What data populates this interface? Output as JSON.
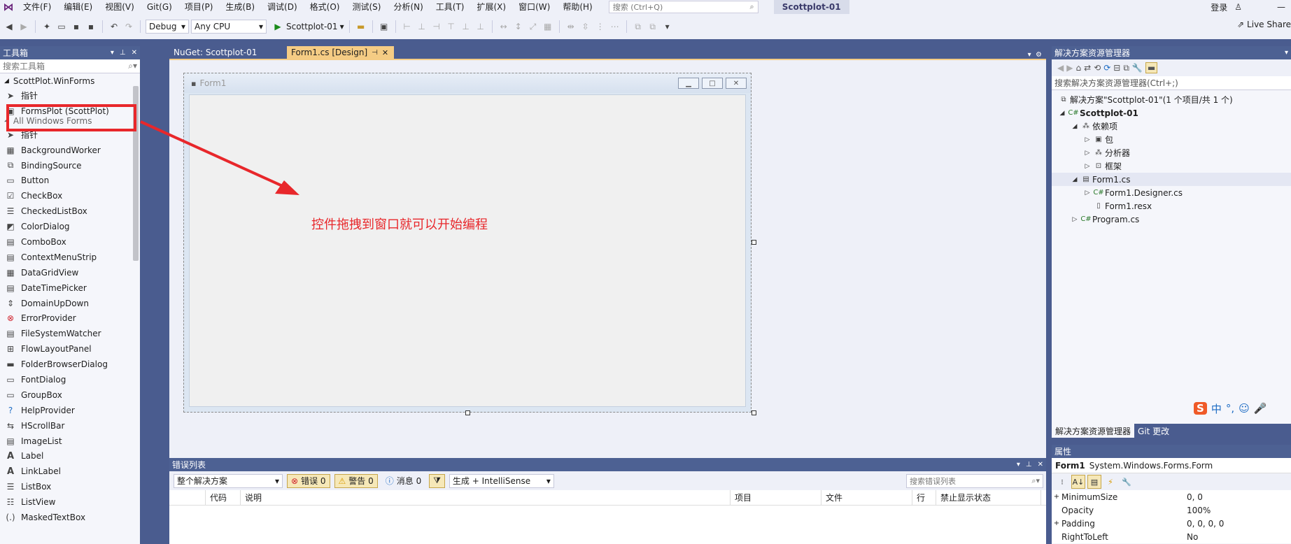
{
  "menubar": {
    "items": [
      "文件(F)",
      "编辑(E)",
      "视图(V)",
      "Git(G)",
      "项目(P)",
      "生成(B)",
      "调试(D)",
      "格式(O)",
      "测试(S)",
      "分析(N)",
      "工具(T)",
      "扩展(X)",
      "窗口(W)",
      "帮助(H)"
    ],
    "search_placeholder": "搜索 (Ctrl+Q)",
    "app_title": "Scottplot-01",
    "login": "登录"
  },
  "toolbar": {
    "config": "Debug",
    "platform": "Any CPU",
    "start_target": "Scottplot-01",
    "live_share": "Live Share"
  },
  "toolbox": {
    "title": "工具箱",
    "search_placeholder": "搜索工具箱",
    "group1": "ScottPlot.WinForms",
    "group1_items": [
      {
        "label": "指针",
        "icon": "pointer-icon"
      },
      {
        "label": "FormsPlot (ScottPlot)",
        "icon": "formsplot-icon"
      }
    ],
    "group2": "All Windows Forms",
    "items": [
      {
        "label": "指针",
        "icon": "pointer-icon"
      },
      {
        "label": "BackgroundWorker",
        "icon": "backgroundworker-icon"
      },
      {
        "label": "BindingSource",
        "icon": "bindingsource-icon"
      },
      {
        "label": "Button",
        "icon": "button-icon"
      },
      {
        "label": "CheckBox",
        "icon": "checkbox-icon"
      },
      {
        "label": "CheckedListBox",
        "icon": "checkedlistbox-icon"
      },
      {
        "label": "ColorDialog",
        "icon": "colordialog-icon"
      },
      {
        "label": "ComboBox",
        "icon": "combobox-icon"
      },
      {
        "label": "ContextMenuStrip",
        "icon": "contextmenustrip-icon"
      },
      {
        "label": "DataGridView",
        "icon": "datagridview-icon"
      },
      {
        "label": "DateTimePicker",
        "icon": "datetimepicker-icon"
      },
      {
        "label": "DomainUpDown",
        "icon": "domainupdown-icon"
      },
      {
        "label": "ErrorProvider",
        "icon": "errorprovider-icon"
      },
      {
        "label": "FileSystemWatcher",
        "icon": "filesystemwatcher-icon"
      },
      {
        "label": "FlowLayoutPanel",
        "icon": "flowlayoutpanel-icon"
      },
      {
        "label": "FolderBrowserDialog",
        "icon": "folderbrowserdialog-icon"
      },
      {
        "label": "FontDialog",
        "icon": "fontdialog-icon"
      },
      {
        "label": "GroupBox",
        "icon": "groupbox-icon"
      },
      {
        "label": "HelpProvider",
        "icon": "helpprovider-icon"
      },
      {
        "label": "HScrollBar",
        "icon": "hscrollbar-icon"
      },
      {
        "label": "ImageList",
        "icon": "imagelist-icon"
      },
      {
        "label": "Label",
        "icon": "label-icon"
      },
      {
        "label": "LinkLabel",
        "icon": "linklabel-icon"
      },
      {
        "label": "ListBox",
        "icon": "listbox-icon"
      },
      {
        "label": "ListView",
        "icon": "listview-icon"
      },
      {
        "label": "MaskedTextBox",
        "icon": "maskedtextbox-icon"
      }
    ]
  },
  "tabs": {
    "nuget": "NuGet: Scottplot-01",
    "form1": "Form1.cs [Design]"
  },
  "designer": {
    "form_title": "Form1",
    "annotation": "控件拖拽到窗口就可以开始编程"
  },
  "errorlist": {
    "title": "错误列表",
    "scope": "整个解决方案",
    "errors": "错误 0",
    "warnings": "警告 0",
    "messages": "消息 0",
    "build_filter": "生成 + IntelliSense",
    "search_placeholder": "搜索错误列表",
    "columns": [
      "代码",
      "说明",
      "项目",
      "文件",
      "行",
      "禁止显示状态"
    ]
  },
  "solution": {
    "title": "解决方案资源管理器",
    "search_placeholder": "搜索解决方案资源管理器(Ctrl+;)",
    "root": "解决方案\"Scottplot-01\"(1 个项目/共 1 个)",
    "project": "Scottplot-01",
    "dependencies": "依赖项",
    "packages": "包",
    "analyzers": "分析器",
    "frameworks": "框架",
    "form1": "Form1.cs",
    "form1_designer": "Form1.Designer.cs",
    "form1_resx": "Form1.resx",
    "program": "Program.cs",
    "tab_solution": "解决方案资源管理器",
    "tab_git": "Git 更改"
  },
  "ime": {
    "logo": "S",
    "lang": "中"
  },
  "properties": {
    "title": "属性",
    "object_name": "Form1",
    "object_type": "System.Windows.Forms.Form",
    "rows": [
      {
        "name": "MinimumSize",
        "value": "0, 0",
        "expand": "+"
      },
      {
        "name": "Opacity",
        "value": "100%",
        "expand": ""
      },
      {
        "name": "Padding",
        "value": "0, 0, 0, 0",
        "expand": "+"
      },
      {
        "name": "RightToLeft",
        "value": "No",
        "expand": ""
      }
    ]
  },
  "colors": {
    "accent_tab": "#f5cc84",
    "chrome": "#4a5c8f",
    "annotation_red": "#e8272b"
  }
}
